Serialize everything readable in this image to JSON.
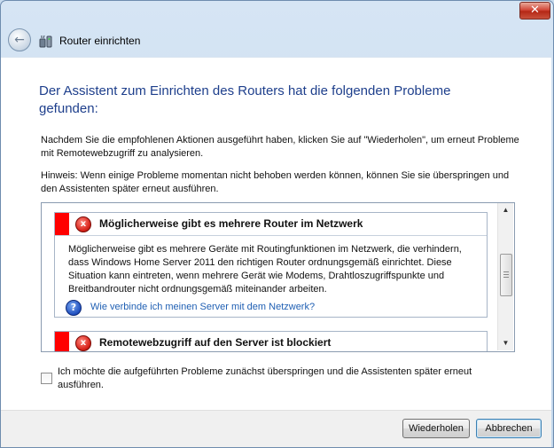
{
  "window": {
    "title": "Router einrichten",
    "close_glyph": "✕",
    "back_glyph": "←"
  },
  "heading": "Der Assistent zum Einrichten des Routers hat die folgenden Probleme gefunden:",
  "intro": "Nachdem Sie die empfohlenen Aktionen ausgeführt haben, klicken Sie auf \"Wiederholen\", um erneut Probleme mit Remotewebzugriff zu analysieren.",
  "hint": "Hinweis: Wenn einige Probleme momentan nicht behoben werden können, können Sie sie überspringen und den Assistenten später erneut ausführen.",
  "problems": [
    {
      "title": "Möglicherweise gibt es mehrere Router im Netzwerk",
      "description": "Möglicherweise gibt es mehrere Geräte mit Routingfunktionen im Netzwerk, die verhindern, dass Windows Home Server 2011 den richtigen Router ordnungsgemäß einrichtet. Diese Situation kann eintreten, wenn mehrere Gerät wie Modems, Drahtloszugriffspunkte und Breitbandrouter nicht ordnungsgemäß miteinander arbeiten.",
      "link": "Wie verbinde ich meinen Server mit dem Netzwerk?"
    },
    {
      "title": "Remotewebzugriff auf den Server ist blockiert"
    }
  ],
  "icons": {
    "error": "x",
    "help": "?",
    "scroll_up": "▲",
    "scroll_down": "▼"
  },
  "skip_checkbox": {
    "label": "Ich möchte die aufgeführten Probleme zunächst überspringen und die Assistenten später erneut ausführen.",
    "checked": false
  },
  "buttons": {
    "retry": "Wiederholen",
    "cancel": "Abbrechen"
  },
  "colors": {
    "accent": "#1e3f8c",
    "error_bar": "#ff0000",
    "link": "#1f5fb3"
  }
}
